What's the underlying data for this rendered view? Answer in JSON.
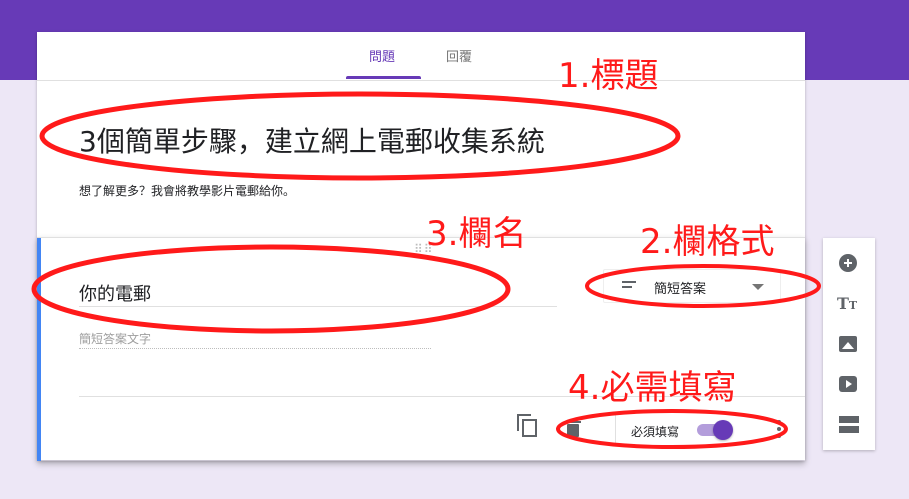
{
  "tabs": {
    "questions": "問題",
    "responses": "回覆"
  },
  "form": {
    "title": "3個簡單步驟，建立網上電郵收集系統",
    "description": "想了解更多？我會將教學影片電郵給你。"
  },
  "question": {
    "title": "你的電郵",
    "type_label": "簡短答案",
    "answer_placeholder": "簡短答案文字",
    "required_label": "必須填寫",
    "required_enabled": true
  },
  "toolbar": {
    "text_icon_label": "T",
    "text_icon_small": "T"
  },
  "annotations": {
    "title": "1.標題",
    "field_format": "2.欄格式",
    "field_name": "3.欄名",
    "required": "4.必需填寫"
  },
  "colors": {
    "header": "#673ab7",
    "background": "#ede7f6",
    "accent": "#673ab7",
    "question_left_bar": "#4285f4",
    "annotation": "#ff1a1a"
  },
  "icons": [
    "drag-handle-icon",
    "short-answer-icon",
    "dropdown-caret-icon",
    "copy-icon",
    "delete-icon",
    "more-vert-icon",
    "add-question-icon",
    "title-text-icon",
    "image-icon",
    "video-icon",
    "section-icon"
  ]
}
